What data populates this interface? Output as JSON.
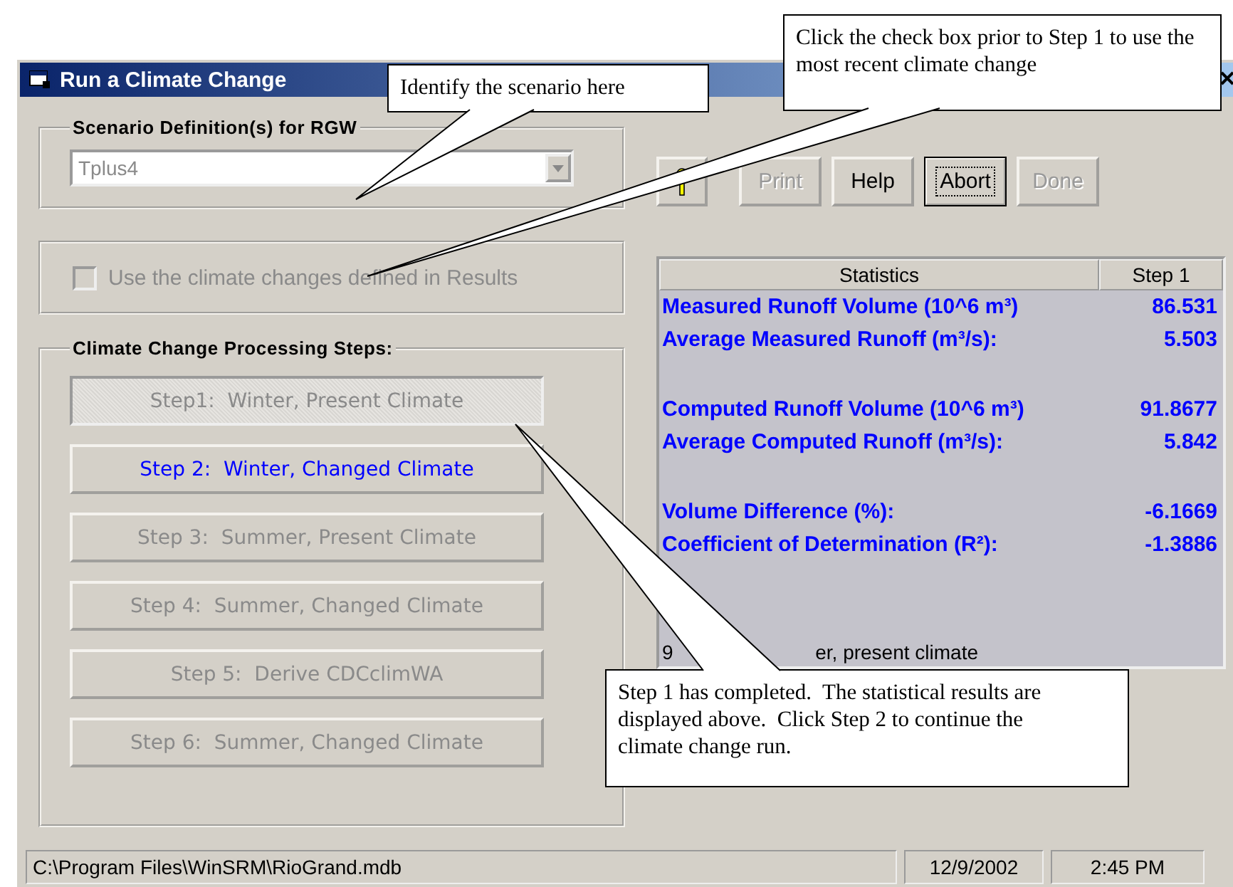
{
  "window": {
    "title": "Run a Climate Change"
  },
  "scenario_group": {
    "label": "Scenario Definition(s) for RGW",
    "combo": {
      "value": "Tplus4",
      "disabled": true
    }
  },
  "climate_option": {
    "label": "Use the climate changes defined in Results",
    "checked": false,
    "disabled": true
  },
  "steps_group": {
    "label": "Climate Change Processing Steps:",
    "steps": [
      {
        "label": "Step1:  Winter, Present Climate",
        "pressed": true,
        "disabled": true
      },
      {
        "label": "Step 2:  Winter, Changed Climate",
        "pressed": false,
        "disabled": false
      },
      {
        "label": "Step 3:  Summer, Present Climate",
        "pressed": false,
        "disabled": true
      },
      {
        "label": "Step 4:  Summer, Changed Climate",
        "pressed": false,
        "disabled": true
      },
      {
        "label": "Step 5:  Derive CDCclimWA",
        "pressed": false,
        "disabled": true
      },
      {
        "label": "Step 6:  Summer, Changed Climate",
        "pressed": false,
        "disabled": true
      }
    ]
  },
  "toolbar": [
    {
      "kind": "icon"
    },
    {
      "kind": "text",
      "label": "Print",
      "disabled": true,
      "focused": false
    },
    {
      "kind": "text",
      "label": "Help",
      "disabled": false,
      "focused": false
    },
    {
      "kind": "text",
      "label": "Abort",
      "disabled": false,
      "focused": true
    },
    {
      "kind": "text",
      "label": "Done",
      "disabled": true,
      "focused": false
    }
  ],
  "statistics": {
    "columns": [
      "Statistics",
      "Step 1"
    ],
    "groups": [
      [
        {
          "label": "Measured Runoff Volume (10^6 m³)",
          "value": "86.531"
        },
        {
          "label": "Average Measured Runoff (m³/s):",
          "value": "5.503"
        }
      ],
      [
        {
          "label": "Computed Runoff Volume (10^6 m³)",
          "value": "91.8677"
        },
        {
          "label": "Average Computed Runoff  (m³/s):",
          "value": "5.842"
        }
      ],
      [
        {
          "label": "Volume Difference (%):",
          "value": "-6.1669"
        },
        {
          "label": "Coefficient of Determination (R²):",
          "value": "-1.3886"
        }
      ]
    ],
    "footer": [
      "9",
      "er, present climate"
    ]
  },
  "status_bar": [
    "C:\\Program Files\\WinSRM\\RioGrand.mdb",
    "12/9/2002",
    "2:45 PM"
  ],
  "callouts": [
    {
      "text": "Identify the scenario here"
    },
    {
      "text": "Click the check box prior to Step 1 to use the most recent climate change"
    },
    {
      "text": "Step 1 has completed.  The statistical results are displayed above.  Click Step 2 to continue the climate change run."
    }
  ]
}
